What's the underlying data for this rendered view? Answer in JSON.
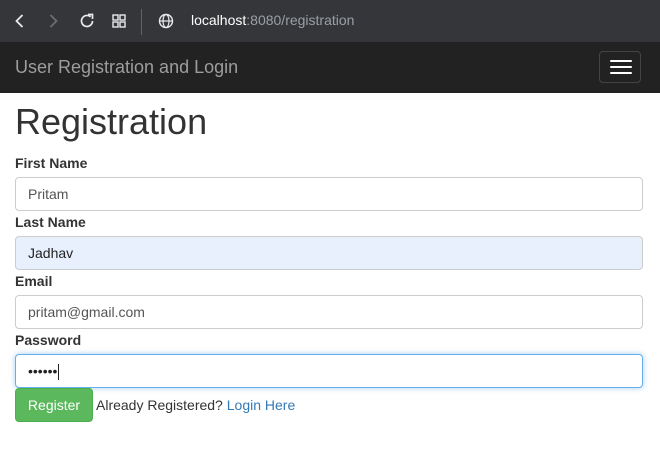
{
  "browser": {
    "url_host": "localhost",
    "url_path": ":8080/registration",
    "icons": [
      "back-icon",
      "forward-icon",
      "reload-icon",
      "apps-icon",
      "globe-icon"
    ]
  },
  "navbar": {
    "brand": "User Registration and Login",
    "toggle_icon": "hamburger-menu-icon"
  },
  "page": {
    "title": "Registration"
  },
  "form": {
    "first_name_label": "First Name",
    "first_name_value": "Pritam",
    "last_name_label": "Last Name",
    "last_name_value": "Jadhav",
    "email_label": "Email",
    "email_value": "pritam@gmail.com",
    "password_label": "Password",
    "password_value": "••••••",
    "register_label": "Register",
    "already_text": "Already Registered?",
    "login_link": "Login Here"
  },
  "colors": {
    "navbar_bg": "#222222",
    "register_button": "#5cb85c",
    "link": "#337ab7",
    "autofill_bg": "#e8f0fe",
    "focus_border": "#66afe9"
  }
}
